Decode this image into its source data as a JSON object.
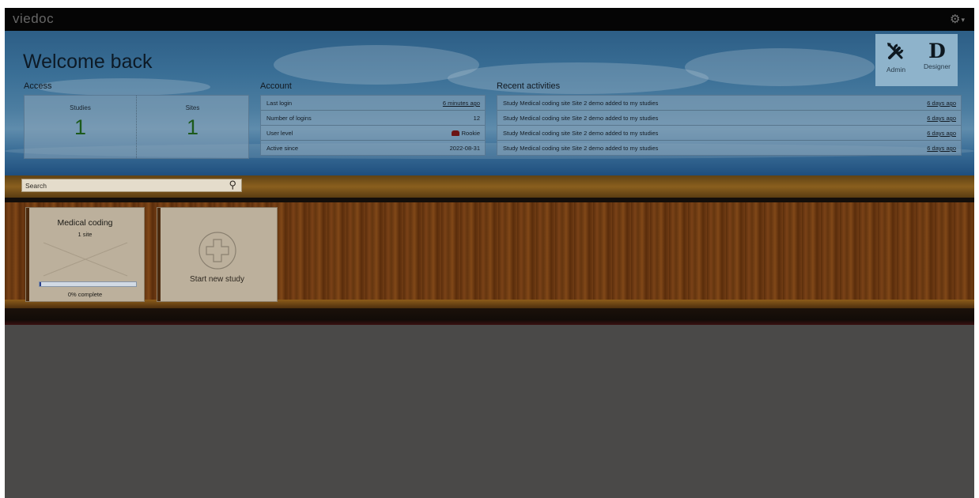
{
  "app": {
    "logo": "viedoc",
    "settings_icon": "gear-icon"
  },
  "hero": {
    "welcome": "Welcome back"
  },
  "access": {
    "label": "Access",
    "studies_label": "Studies",
    "studies_value": "1",
    "sites_label": "Sites",
    "sites_value": "1"
  },
  "account": {
    "label": "Account",
    "rows": [
      {
        "key": "Last login",
        "value": "6 minutes ago"
      },
      {
        "key": "Number of logins",
        "value": "12"
      },
      {
        "key": "User level",
        "value": "Rookie"
      },
      {
        "key": "Active since",
        "value": "2022-08-31"
      }
    ]
  },
  "recent": {
    "label": "Recent activities",
    "rows": [
      {
        "text": "Study Medical coding site Site 2 demo added to my studies",
        "time": "6 days ago"
      },
      {
        "text": "Study Medical coding site Site 2 demo added to my studies",
        "time": "6 days ago"
      },
      {
        "text": "Study Medical coding site Site 2 demo added to my studies",
        "time": "6 days ago"
      },
      {
        "text": "Study Medical coding site Site 2 demo added to my studies",
        "time": "6 days ago"
      }
    ]
  },
  "tools": {
    "admin_label": "Admin",
    "admin_icon": "tools-icon",
    "designer_label": "Designer",
    "designer_glyph": "D"
  },
  "search": {
    "placeholder": "Search"
  },
  "studies": [
    {
      "title": "Medical coding",
      "sites": "1 site",
      "progress": 0.0,
      "progress_label": "0% complete"
    }
  ],
  "new_study": {
    "label": "Start new study"
  },
  "colors": {
    "hero_blue": "#3a6f96",
    "progress_blue": "#2a3f8a",
    "count_green": "#1c5a1c",
    "badge_red": "#6b1414"
  }
}
